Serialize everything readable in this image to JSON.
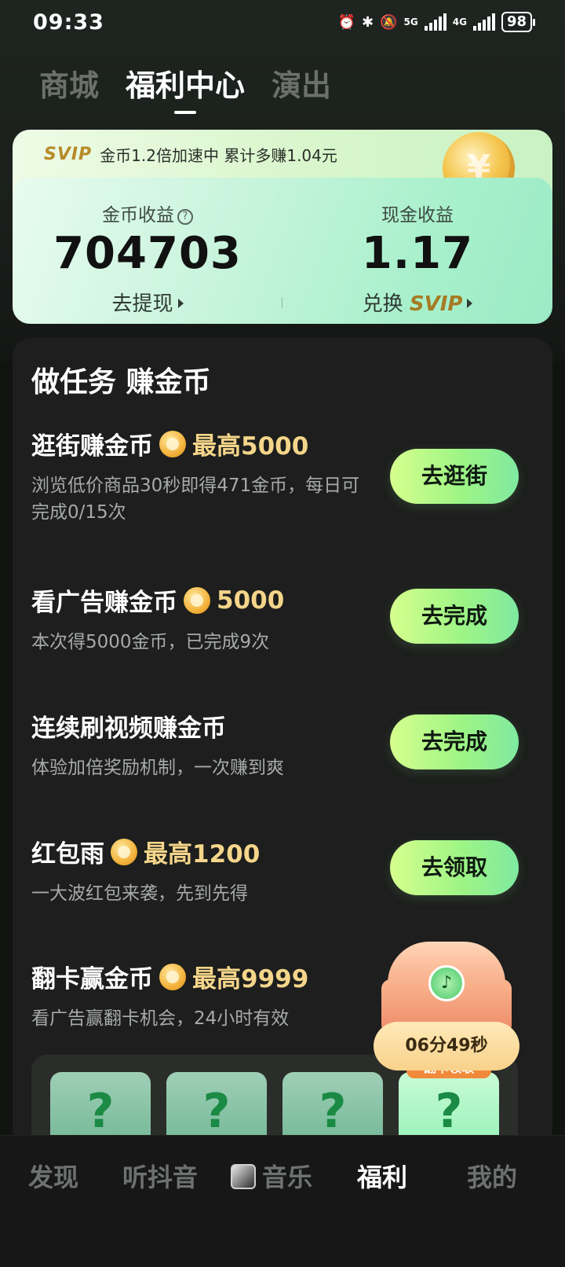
{
  "status": {
    "time": "09:33",
    "net1": "5G",
    "net2": "4G",
    "battery": "98"
  },
  "top_tabs": [
    {
      "label": "商城",
      "active": false
    },
    {
      "label": "福利中心",
      "active": true
    },
    {
      "label": "演出",
      "active": false
    }
  ],
  "svip_banner": {
    "tag": "SVIP",
    "text": "金币1.2倍加速中 累计多赚1.04元"
  },
  "earnings": {
    "coin_label": "金币收益",
    "coin_value": "704703",
    "coin_link": "去提现",
    "cash_label": "现金收益",
    "cash_value": "1.17",
    "cash_link_prefix": "兑换",
    "cash_link_svip": "SVIP"
  },
  "tasks_title": "做任务 赚金币",
  "tasks": [
    {
      "title": "逛街赚金币",
      "reward": "最高5000",
      "desc": "浏览低价商品30秒即得471金币，每日可完成0/15次",
      "button": "去逛街"
    },
    {
      "title": "看广告赚金币",
      "reward": "5000",
      "desc": "本次得5000金币，已完成9次",
      "button": "去完成"
    },
    {
      "title": "连续刷视频赚金币",
      "reward": "",
      "desc": "体验加倍奖励机制，一次赚到爽",
      "button": "去完成"
    },
    {
      "title": "红包雨",
      "reward": "最高1200",
      "desc": "一大波红包来袭，先到先得",
      "button": "去领取"
    },
    {
      "title": "翻卡赢金币",
      "reward": "最高9999",
      "desc": "看广告赢翻卡机会，24小时有效",
      "button": ""
    }
  ],
  "flip_cards": [
    "?",
    "?",
    "?",
    "?"
  ],
  "flip_hint": "翻卡领取",
  "chest": {
    "timer": "06分49秒"
  },
  "bottom_nav": [
    {
      "label": "发现",
      "active": false
    },
    {
      "label": "听抖音",
      "active": false
    },
    {
      "label": "音乐",
      "active": false
    },
    {
      "label": "福利",
      "active": true
    },
    {
      "label": "我的",
      "active": false
    }
  ]
}
